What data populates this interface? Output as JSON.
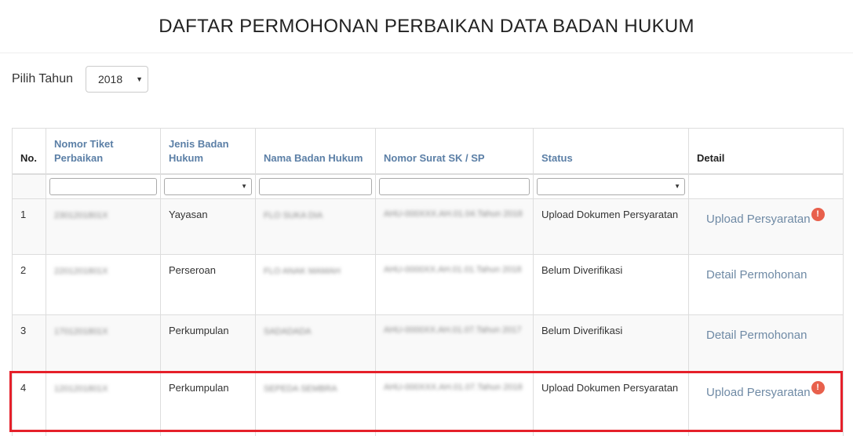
{
  "page": {
    "title": "DAFTAR PERMOHONAN PERBAIKAN DATA BADAN HUKUM"
  },
  "filter": {
    "label": "Pilih Tahun",
    "year": "2018"
  },
  "table": {
    "headers": [
      "No.",
      "Nomor Tiket Perbaikan",
      "Jenis Badan Hukum",
      "Nama Badan Hukum",
      "Nomor Surat SK / SP",
      "Status",
      "Detail"
    ],
    "rows": [
      {
        "no": "1",
        "ticket": "2301201801X",
        "jenis": "Yayasan",
        "nama": "FLO SUKA DIA",
        "sk": "AHU-000XXX.AH.01.04.Tahun 2018",
        "status": "Upload Dokumen Persyaratan",
        "detail": "Upload Persyaratan",
        "alert": "!"
      },
      {
        "no": "2",
        "ticket": "2201201801X",
        "jenis": "Perseroan",
        "nama": "FLO ANAK MAMAH",
        "sk": "AHU-0000XX.AH.01.01.Tahun 2018",
        "status": "Belum Diverifikasi",
        "detail": "Detail Permohonan",
        "alert": ""
      },
      {
        "no": "3",
        "ticket": "1701201801X",
        "jenis": "Perkumpulan",
        "nama": "SADADADA",
        "sk": "AHU-0000XX.AH.01.07.Tahun 2017",
        "status": "Belum Diverifikasi",
        "detail": "Detail Permohonan",
        "alert": ""
      },
      {
        "no": "4",
        "ticket": "1201201801X",
        "jenis": "Perkumpulan",
        "nama": "SEPEDA SEMBRA",
        "sk": "AHU-000XXX.AH.01.07.Tahun 2018",
        "status": "Upload Dokumen Persyaratan",
        "detail": "Upload Persyaratan",
        "alert": "!"
      }
    ]
  },
  "colors": {
    "header_link": "#5b7fa6",
    "detail_link": "#6f8aa5",
    "alert": "#e8604c",
    "highlight": "#e5202a"
  },
  "icons": {
    "alert": "exclamation-circle-icon",
    "dropdown": "caret-down-icon"
  }
}
